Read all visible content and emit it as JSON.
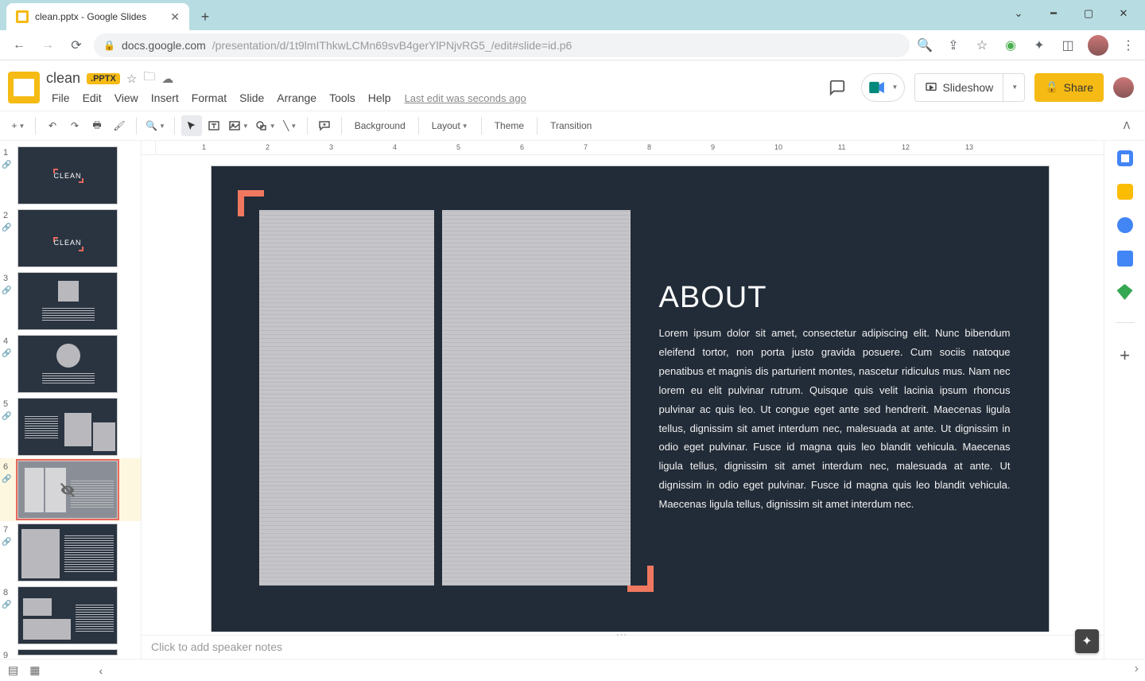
{
  "browser": {
    "tab_title": "clean.pptx - Google Slides",
    "url_host": "docs.google.com",
    "url_path": "/presentation/d/1t9lmIThkwLCMn69svB4gerYlPNjvRG5_/edit#slide=id.p6"
  },
  "doc": {
    "title": "clean",
    "badge": ".PPTX",
    "last_edit": "Last edit was seconds ago"
  },
  "menu": {
    "file": "File",
    "edit": "Edit",
    "view": "View",
    "insert": "Insert",
    "format": "Format",
    "slide": "Slide",
    "arrange": "Arrange",
    "tools": "Tools",
    "help": "Help"
  },
  "header_buttons": {
    "slideshow": "Slideshow",
    "share": "Share"
  },
  "toolbar": {
    "background": "Background",
    "layout": "Layout",
    "theme": "Theme",
    "transition": "Transition"
  },
  "filmstrip": {
    "slides": [
      {
        "n": "1"
      },
      {
        "n": "2"
      },
      {
        "n": "3"
      },
      {
        "n": "4"
      },
      {
        "n": "5"
      },
      {
        "n": "6"
      },
      {
        "n": "7"
      },
      {
        "n": "8"
      },
      {
        "n": "9"
      }
    ],
    "clean_label": "CLEAN"
  },
  "slide": {
    "title": "ABOUT",
    "body": "Lorem ipsum dolor sit amet, consectetur adipiscing elit. Nunc bibendum eleifend tortor, non porta justo gravida posuere. Cum sociis natoque penatibus et magnis dis parturient montes, nascetur ridiculus mus. Nam nec lorem eu elit pulvinar rutrum. Quisque quis velit lacinia ipsum rhoncus pulvinar ac quis leo. Ut congue eget ante sed hendrerit. Maecenas ligula tellus, dignissim sit amet interdum nec, malesuada at ante. Ut dignissim in odio eget pulvinar. Fusce id magna quis leo blandit vehicula. Maecenas ligula tellus, dignissim sit amet interdum nec, malesuada at ante. Ut dignissim in odio eget pulvinar. Fusce id magna quis leo blandit vehicula. Maecenas ligula tellus, dignissim sit amet interdum nec."
  },
  "notes": {
    "placeholder": "Click to add speaker notes"
  },
  "ruler": [
    "1",
    "2",
    "3",
    "4",
    "5",
    "6",
    "7",
    "8",
    "9",
    "10",
    "11",
    "12",
    "13"
  ]
}
